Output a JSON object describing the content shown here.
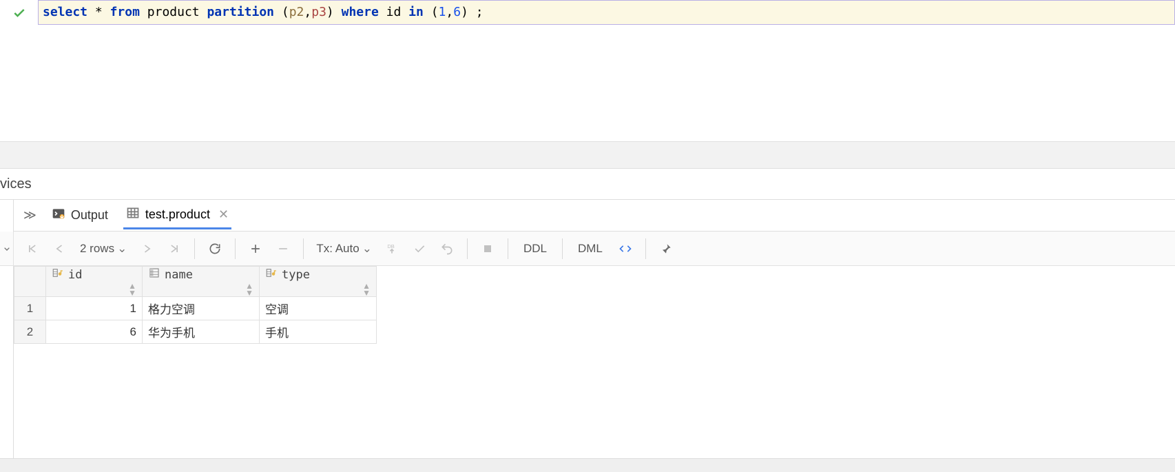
{
  "editor": {
    "sql_tokens": [
      {
        "t": "select",
        "c": "kw"
      },
      {
        "t": " ",
        "c": "sp"
      },
      {
        "t": "*",
        "c": "star"
      },
      {
        "t": " ",
        "c": "sp"
      },
      {
        "t": "from",
        "c": "kw"
      },
      {
        "t": " ",
        "c": "sp"
      },
      {
        "t": "product",
        "c": "id"
      },
      {
        "t": " ",
        "c": "sp"
      },
      {
        "t": "partition",
        "c": "kw"
      },
      {
        "t": " ",
        "c": "sp"
      },
      {
        "t": "(",
        "c": "punc"
      },
      {
        "t": "p2",
        "c": "p2"
      },
      {
        "t": ",",
        "c": "punc"
      },
      {
        "t": "p3",
        "c": "p3"
      },
      {
        "t": ")",
        "c": "punc"
      },
      {
        "t": " ",
        "c": "sp"
      },
      {
        "t": "where",
        "c": "kw"
      },
      {
        "t": " ",
        "c": "sp"
      },
      {
        "t": "id",
        "c": "id"
      },
      {
        "t": " ",
        "c": "sp"
      },
      {
        "t": "in",
        "c": "kw"
      },
      {
        "t": " ",
        "c": "sp"
      },
      {
        "t": "(",
        "c": "punc"
      },
      {
        "t": "1",
        "c": "num"
      },
      {
        "t": ",",
        "c": "punc"
      },
      {
        "t": "6",
        "c": "num"
      },
      {
        "t": ")",
        "c": "punc"
      },
      {
        "t": " ;",
        "c": "punc"
      }
    ]
  },
  "truncated_label": "vices",
  "tabs": {
    "expand_label": "≫",
    "output": "Output",
    "result": "test.product"
  },
  "toolbar": {
    "rows_label": "2 rows",
    "tx_label": "Tx: Auto",
    "ddl": "DDL",
    "dml": "DML"
  },
  "grid": {
    "columns": [
      {
        "key": "id",
        "label": "id",
        "kind": "key"
      },
      {
        "key": "name",
        "label": "name",
        "kind": "col"
      },
      {
        "key": "type",
        "label": "type",
        "kind": "key"
      }
    ],
    "rows": [
      {
        "n": "1",
        "id": "1",
        "name": "格力空调",
        "type": "空调"
      },
      {
        "n": "2",
        "id": "6",
        "name": "华为手机",
        "type": "手机"
      }
    ]
  }
}
